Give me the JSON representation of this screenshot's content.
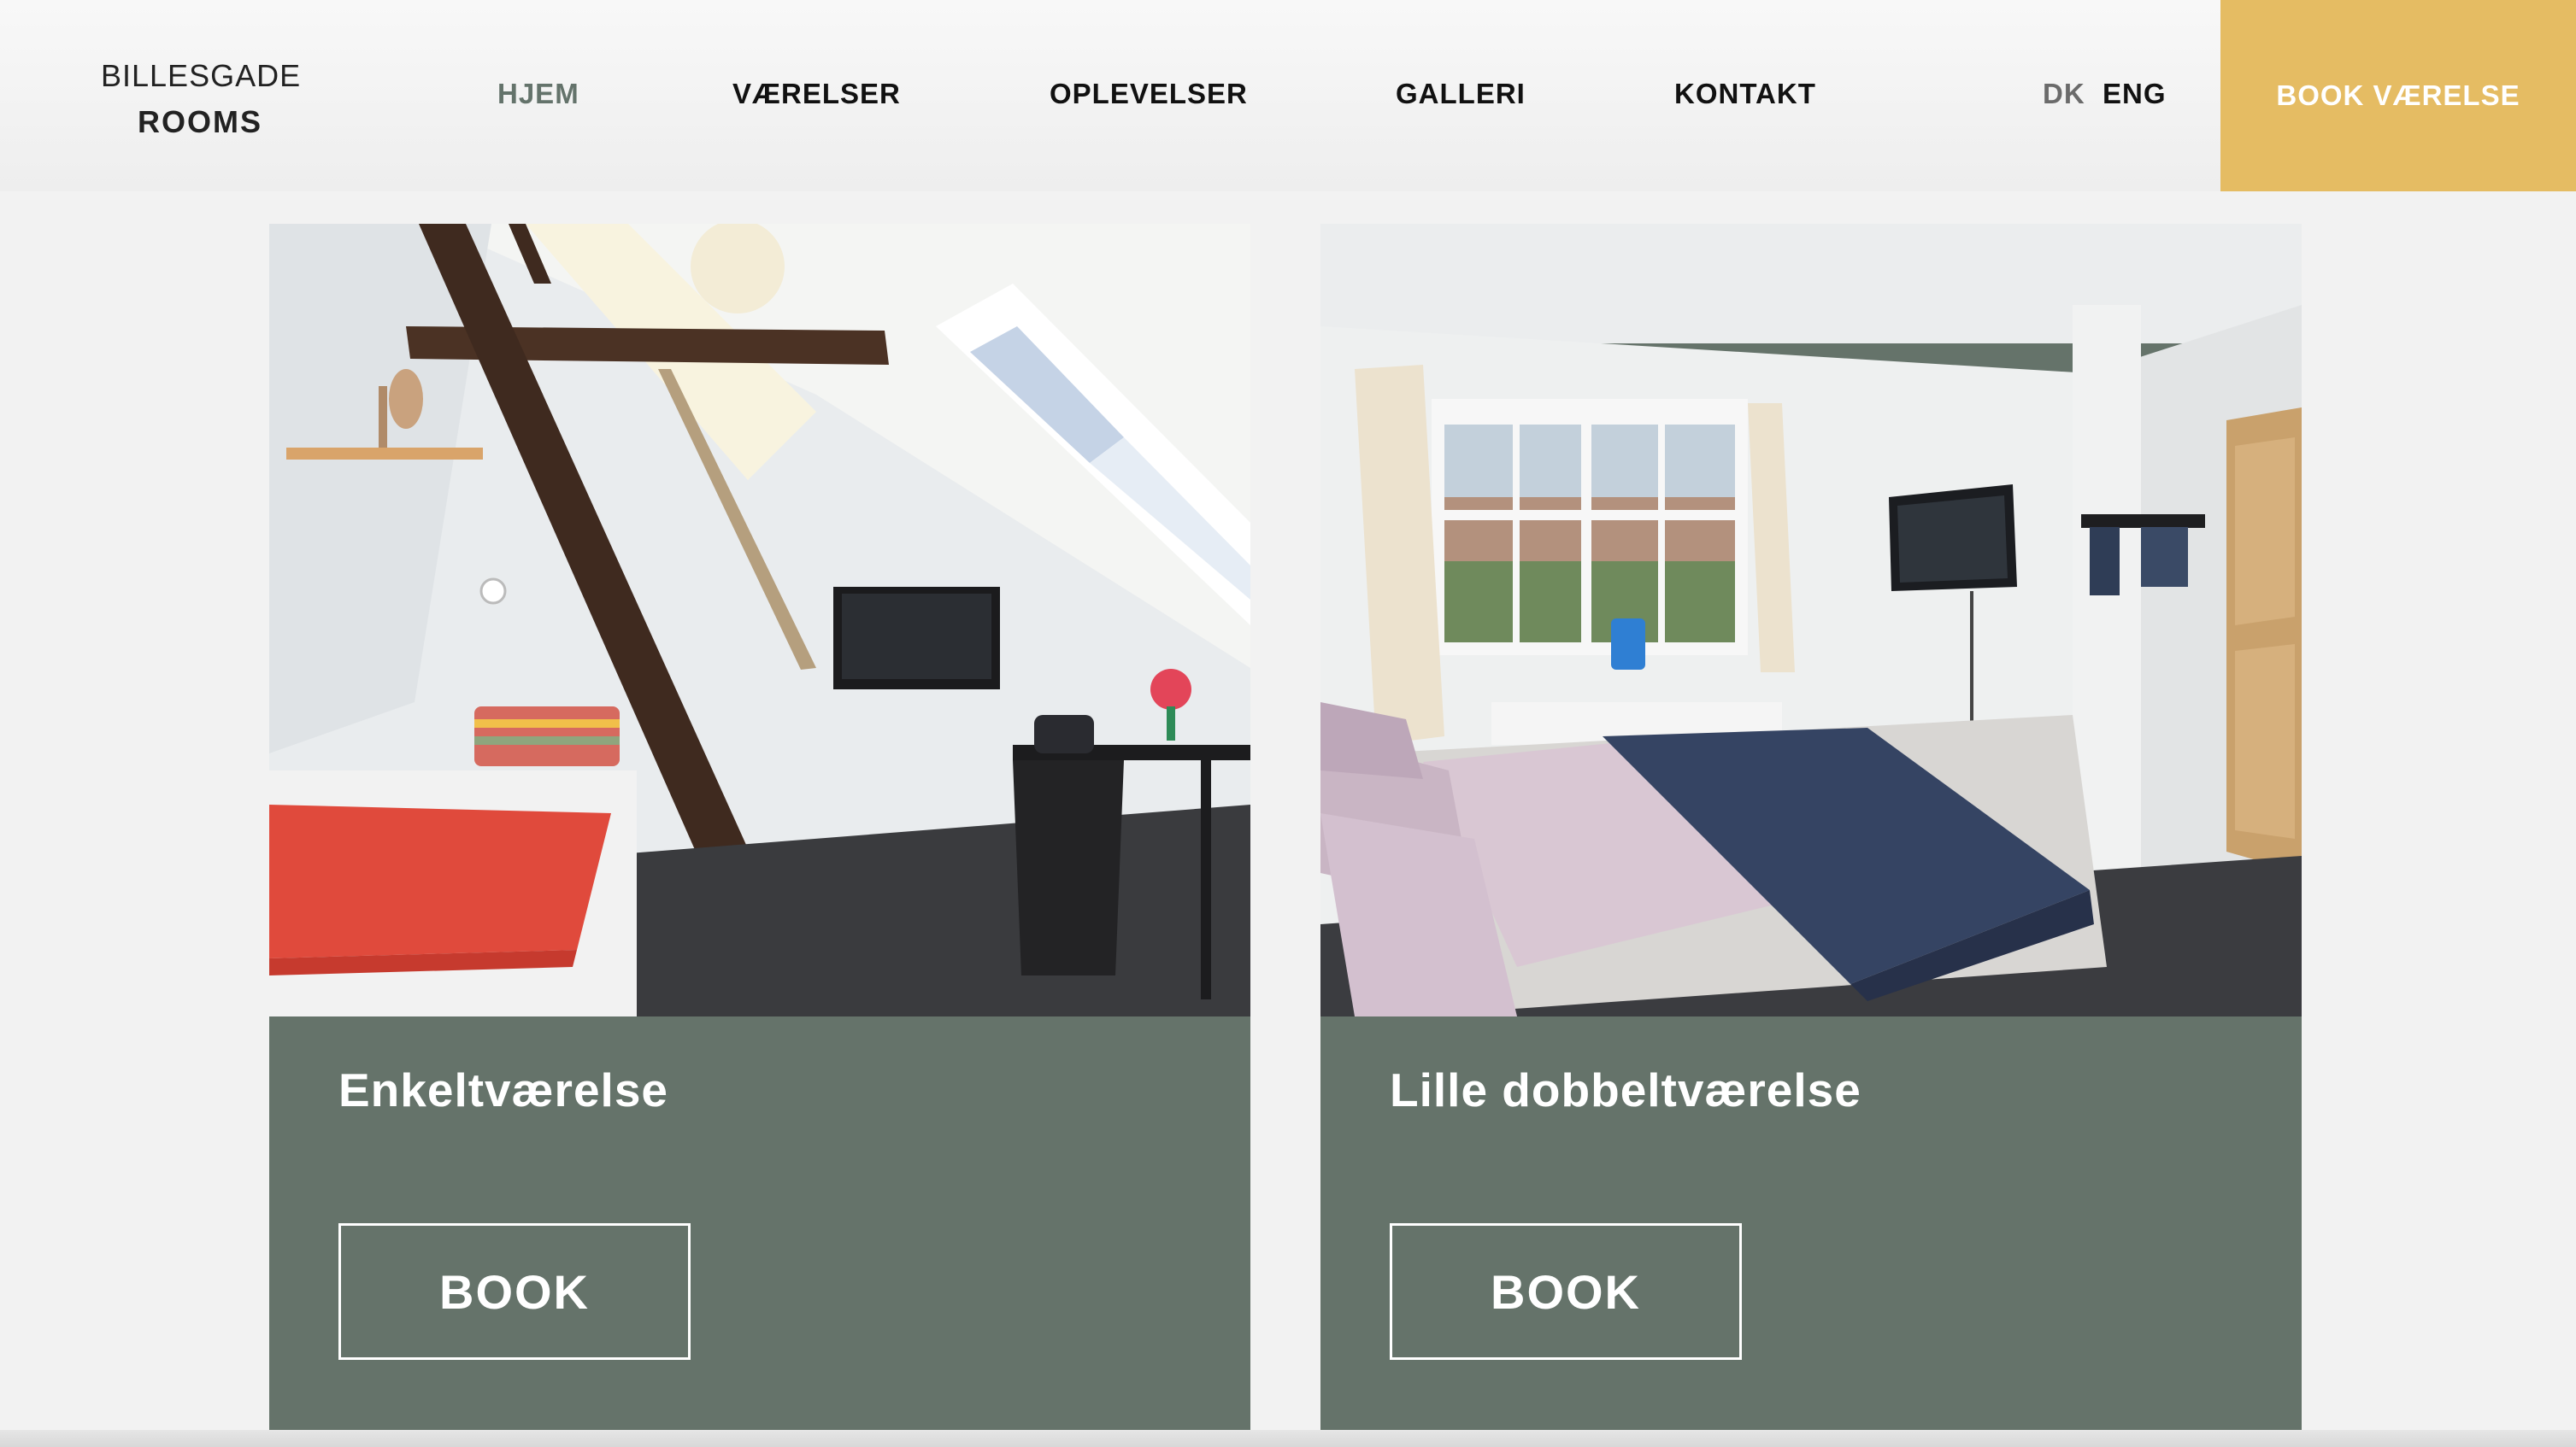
{
  "brand": {
    "line1": "BILLESGADE",
    "line2": "ROOMS"
  },
  "nav": {
    "items": [
      {
        "label": "HJEM",
        "active": true
      },
      {
        "label": "VÆRELSER",
        "active": false
      },
      {
        "label": "OPLEVELSER",
        "active": false
      },
      {
        "label": "GALLERI",
        "active": false
      },
      {
        "label": "KONTAKT",
        "active": false
      }
    ],
    "languages": [
      {
        "label": "DK",
        "selected": false
      },
      {
        "label": "ENG",
        "selected": true
      }
    ],
    "cta_label": "BOOK VÆRELSE"
  },
  "rooms": [
    {
      "title": "Enkeltværelse",
      "book_label": "BOOK",
      "photo": "single-room-photo"
    },
    {
      "title": "Lille dobbeltværelse",
      "book_label": "BOOK",
      "photo": "small-double-room-photo"
    }
  ],
  "colors": {
    "accent": "#e5bc63",
    "card_bg": "#65736a",
    "active_nav": "#64736b",
    "page_bg": "#f2f2f2"
  }
}
